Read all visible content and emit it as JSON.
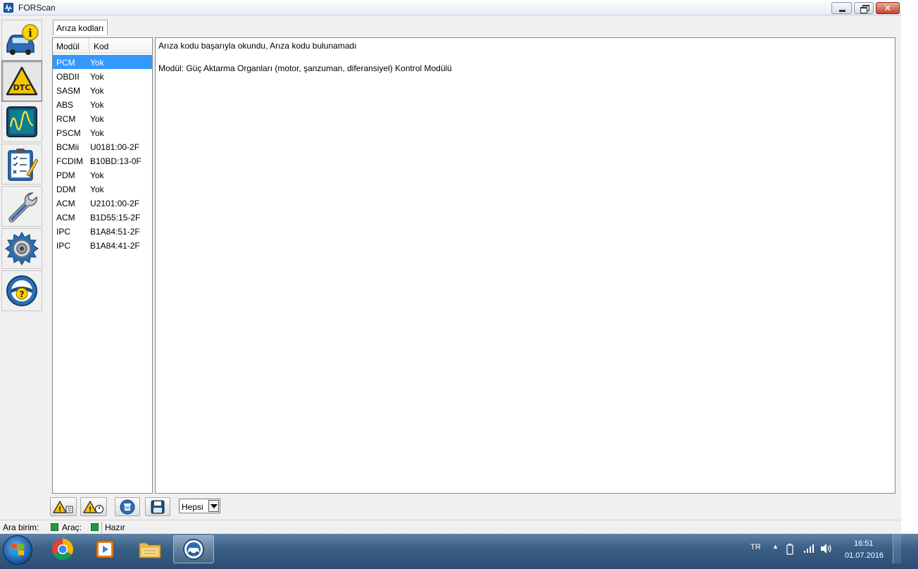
{
  "window": {
    "title": "FORScan",
    "close_glyph": "✕"
  },
  "sidebar": {
    "items": [
      {
        "name": "vehicle-info",
        "icon": "car-info-icon"
      },
      {
        "name": "dtc",
        "icon": "dtc-warning-icon",
        "label": "DTC",
        "active": true
      },
      {
        "name": "oscilloscope",
        "icon": "oscilloscope-icon"
      },
      {
        "name": "tests",
        "icon": "checklist-icon"
      },
      {
        "name": "service",
        "icon": "wrench-icon"
      },
      {
        "name": "configuration",
        "icon": "gear-icon"
      },
      {
        "name": "help",
        "icon": "help-steering-icon"
      }
    ]
  },
  "tab": {
    "label": "Arıza kodları"
  },
  "module_table": {
    "columns": [
      "Modül",
      "Kod"
    ],
    "rows": [
      {
        "module": "PCM",
        "code": "Yok",
        "selected": true
      },
      {
        "module": "OBDII",
        "code": "Yok"
      },
      {
        "module": "SASM",
        "code": "Yok"
      },
      {
        "module": "ABS",
        "code": "Yok"
      },
      {
        "module": "RCM",
        "code": "Yok"
      },
      {
        "module": "PSCM",
        "code": "Yok"
      },
      {
        "module": "BCMii",
        "code": "U0181:00-2F"
      },
      {
        "module": "FCDIM",
        "code": "B10BD:13-0F"
      },
      {
        "module": "PDM",
        "code": "Yok"
      },
      {
        "module": "DDM",
        "code": "Yok"
      },
      {
        "module": "ACM",
        "code": "U2101:00-2F"
      },
      {
        "module": "ACM",
        "code": "B1D55:15-2F"
      },
      {
        "module": "IPC",
        "code": "B1A84:51-2F"
      },
      {
        "module": "IPC",
        "code": "B1A84:41-2F"
      }
    ]
  },
  "details": {
    "line1": "Arıza kodu başarıyla okundu, Arıza kodu bulunamadı",
    "line2": "Modül: Güç Aktarma Organları (motor, şanzuman, diferansiyel) Kontrol Modülü"
  },
  "toolbar": {
    "buttons": [
      "read-dtc-icon",
      "clear-dtc-icon",
      "delete-icon",
      "save-icon"
    ],
    "filter_value": "Hepsi"
  },
  "statusbar": {
    "interface_label": "Ara birim:",
    "vehicle_label": "Araç:",
    "status_text": "Hazır",
    "indicator_color": "#1e9b3c"
  },
  "taskbar": {
    "apps": [
      "chrome-icon",
      "media-player-icon",
      "file-explorer-icon",
      "forscan-icon"
    ],
    "language": "TR",
    "time": "16:51",
    "date": "01.07.2016"
  }
}
